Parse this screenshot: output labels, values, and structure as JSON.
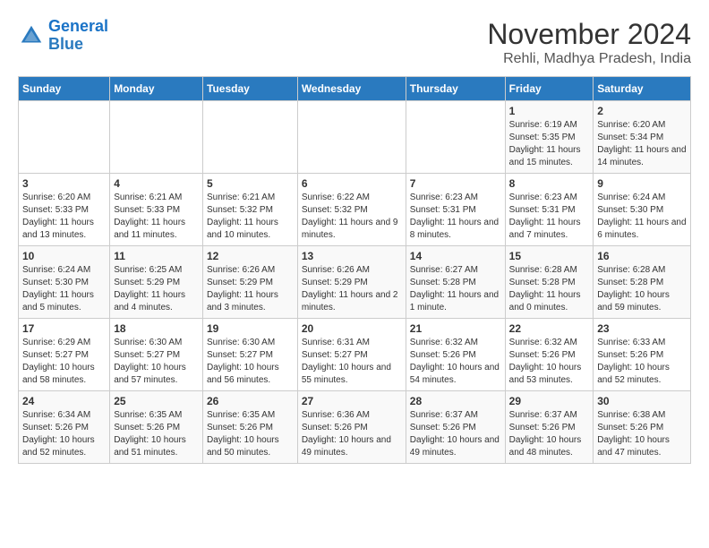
{
  "logo": {
    "line1": "General",
    "line2": "Blue"
  },
  "title": "November 2024",
  "subtitle": "Rehli, Madhya Pradesh, India",
  "weekdays": [
    "Sunday",
    "Monday",
    "Tuesday",
    "Wednesday",
    "Thursday",
    "Friday",
    "Saturday"
  ],
  "weeks": [
    [
      {
        "day": "",
        "info": ""
      },
      {
        "day": "",
        "info": ""
      },
      {
        "day": "",
        "info": ""
      },
      {
        "day": "",
        "info": ""
      },
      {
        "day": "",
        "info": ""
      },
      {
        "day": "1",
        "info": "Sunrise: 6:19 AM\nSunset: 5:35 PM\nDaylight: 11 hours and 15 minutes."
      },
      {
        "day": "2",
        "info": "Sunrise: 6:20 AM\nSunset: 5:34 PM\nDaylight: 11 hours and 14 minutes."
      }
    ],
    [
      {
        "day": "3",
        "info": "Sunrise: 6:20 AM\nSunset: 5:33 PM\nDaylight: 11 hours and 13 minutes."
      },
      {
        "day": "4",
        "info": "Sunrise: 6:21 AM\nSunset: 5:33 PM\nDaylight: 11 hours and 11 minutes."
      },
      {
        "day": "5",
        "info": "Sunrise: 6:21 AM\nSunset: 5:32 PM\nDaylight: 11 hours and 10 minutes."
      },
      {
        "day": "6",
        "info": "Sunrise: 6:22 AM\nSunset: 5:32 PM\nDaylight: 11 hours and 9 minutes."
      },
      {
        "day": "7",
        "info": "Sunrise: 6:23 AM\nSunset: 5:31 PM\nDaylight: 11 hours and 8 minutes."
      },
      {
        "day": "8",
        "info": "Sunrise: 6:23 AM\nSunset: 5:31 PM\nDaylight: 11 hours and 7 minutes."
      },
      {
        "day": "9",
        "info": "Sunrise: 6:24 AM\nSunset: 5:30 PM\nDaylight: 11 hours and 6 minutes."
      }
    ],
    [
      {
        "day": "10",
        "info": "Sunrise: 6:24 AM\nSunset: 5:30 PM\nDaylight: 11 hours and 5 minutes."
      },
      {
        "day": "11",
        "info": "Sunrise: 6:25 AM\nSunset: 5:29 PM\nDaylight: 11 hours and 4 minutes."
      },
      {
        "day": "12",
        "info": "Sunrise: 6:26 AM\nSunset: 5:29 PM\nDaylight: 11 hours and 3 minutes."
      },
      {
        "day": "13",
        "info": "Sunrise: 6:26 AM\nSunset: 5:29 PM\nDaylight: 11 hours and 2 minutes."
      },
      {
        "day": "14",
        "info": "Sunrise: 6:27 AM\nSunset: 5:28 PM\nDaylight: 11 hours and 1 minute."
      },
      {
        "day": "15",
        "info": "Sunrise: 6:28 AM\nSunset: 5:28 PM\nDaylight: 11 hours and 0 minutes."
      },
      {
        "day": "16",
        "info": "Sunrise: 6:28 AM\nSunset: 5:28 PM\nDaylight: 10 hours and 59 minutes."
      }
    ],
    [
      {
        "day": "17",
        "info": "Sunrise: 6:29 AM\nSunset: 5:27 PM\nDaylight: 10 hours and 58 minutes."
      },
      {
        "day": "18",
        "info": "Sunrise: 6:30 AM\nSunset: 5:27 PM\nDaylight: 10 hours and 57 minutes."
      },
      {
        "day": "19",
        "info": "Sunrise: 6:30 AM\nSunset: 5:27 PM\nDaylight: 10 hours and 56 minutes."
      },
      {
        "day": "20",
        "info": "Sunrise: 6:31 AM\nSunset: 5:27 PM\nDaylight: 10 hours and 55 minutes."
      },
      {
        "day": "21",
        "info": "Sunrise: 6:32 AM\nSunset: 5:26 PM\nDaylight: 10 hours and 54 minutes."
      },
      {
        "day": "22",
        "info": "Sunrise: 6:32 AM\nSunset: 5:26 PM\nDaylight: 10 hours and 53 minutes."
      },
      {
        "day": "23",
        "info": "Sunrise: 6:33 AM\nSunset: 5:26 PM\nDaylight: 10 hours and 52 minutes."
      }
    ],
    [
      {
        "day": "24",
        "info": "Sunrise: 6:34 AM\nSunset: 5:26 PM\nDaylight: 10 hours and 52 minutes."
      },
      {
        "day": "25",
        "info": "Sunrise: 6:35 AM\nSunset: 5:26 PM\nDaylight: 10 hours and 51 minutes."
      },
      {
        "day": "26",
        "info": "Sunrise: 6:35 AM\nSunset: 5:26 PM\nDaylight: 10 hours and 50 minutes."
      },
      {
        "day": "27",
        "info": "Sunrise: 6:36 AM\nSunset: 5:26 PM\nDaylight: 10 hours and 49 minutes."
      },
      {
        "day": "28",
        "info": "Sunrise: 6:37 AM\nSunset: 5:26 PM\nDaylight: 10 hours and 49 minutes."
      },
      {
        "day": "29",
        "info": "Sunrise: 6:37 AM\nSunset: 5:26 PM\nDaylight: 10 hours and 48 minutes."
      },
      {
        "day": "30",
        "info": "Sunrise: 6:38 AM\nSunset: 5:26 PM\nDaylight: 10 hours and 47 minutes."
      }
    ]
  ]
}
